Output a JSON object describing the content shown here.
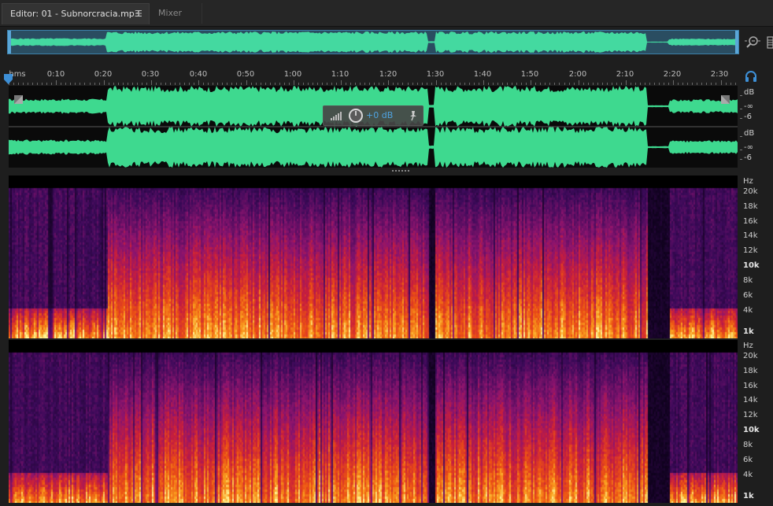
{
  "tabs": {
    "editor_label": "Editor: 01 - Subnorcracia.mp3",
    "editor_menu_icon": "hamburger-menu-icon",
    "mixer_label": "Mixer"
  },
  "ruler": {
    "unit_label": "hms",
    "labels": [
      "0:10",
      "0:20",
      "0:30",
      "0:40",
      "0:50",
      "1:00",
      "1:10",
      "1:20",
      "1:30",
      "1:40",
      "1:50",
      "2:00",
      "2:10",
      "2:20",
      "2:30"
    ]
  },
  "hud": {
    "gain_value": "+0 dB"
  },
  "db_scale": {
    "ch1": {
      "unit": "dB",
      "inf": "-∞",
      "val": "-6"
    },
    "ch2": {
      "unit": "dB",
      "inf": "-∞",
      "val": "-6"
    }
  },
  "hz_scale": {
    "unit": "Hz",
    "labels": [
      "20k",
      "18k",
      "16k",
      "14k",
      "12k",
      "10k",
      "8k",
      "6k",
      "4k",
      "1k"
    ]
  },
  "colors": {
    "waveform": "#3ed98f",
    "overview_waveform": "#44d9a0",
    "selection": "#3d7fa8",
    "hud_value": "#4fa3e0"
  },
  "icons": {
    "zoom": "zoom-magnifier-icon",
    "headphones": "headphones-icon",
    "knob": "volume-knob-icon",
    "pin": "pin-icon"
  }
}
